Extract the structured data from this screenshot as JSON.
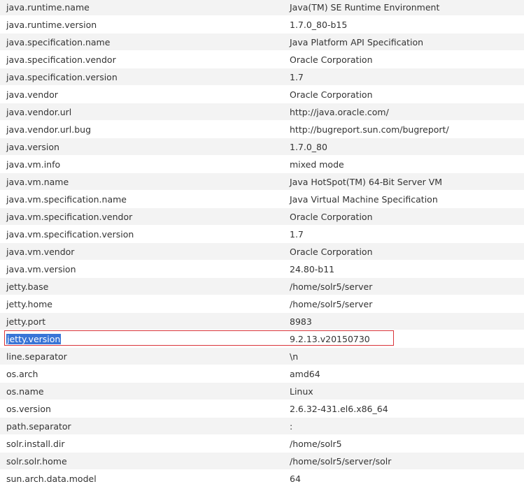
{
  "properties": [
    {
      "key": "java.runtime.name",
      "value": "Java(TM) SE Runtime Environment"
    },
    {
      "key": "java.runtime.version",
      "value": "1.7.0_80-b15"
    },
    {
      "key": "java.specification.name",
      "value": "Java Platform API Specification"
    },
    {
      "key": "java.specification.vendor",
      "value": "Oracle Corporation"
    },
    {
      "key": "java.specification.version",
      "value": "1.7"
    },
    {
      "key": "java.vendor",
      "value": "Oracle Corporation"
    },
    {
      "key": "java.vendor.url",
      "value": "http://java.oracle.com/"
    },
    {
      "key": "java.vendor.url.bug",
      "value": "http://bugreport.sun.com/bugreport/"
    },
    {
      "key": "java.version",
      "value": "1.7.0_80"
    },
    {
      "key": "java.vm.info",
      "value": "mixed mode"
    },
    {
      "key": "java.vm.name",
      "value": "Java HotSpot(TM) 64-Bit Server VM"
    },
    {
      "key": "java.vm.specification.name",
      "value": "Java Virtual Machine Specification"
    },
    {
      "key": "java.vm.specification.vendor",
      "value": "Oracle Corporation"
    },
    {
      "key": "java.vm.specification.version",
      "value": "1.7"
    },
    {
      "key": "java.vm.vendor",
      "value": "Oracle Corporation"
    },
    {
      "key": "java.vm.version",
      "value": "24.80-b11"
    },
    {
      "key": "jetty.base",
      "value": "/home/solr5/server"
    },
    {
      "key": "jetty.home",
      "value": "/home/solr5/server"
    },
    {
      "key": "jetty.port",
      "value": "8983"
    },
    {
      "key": "jetty.version",
      "value": "9.2.13.v20150730",
      "selected": true
    },
    {
      "key": "line.separator",
      "value": "\\n"
    },
    {
      "key": "os.arch",
      "value": "amd64"
    },
    {
      "key": "os.name",
      "value": "Linux"
    },
    {
      "key": "os.version",
      "value": "2.6.32-431.el6.x86_64"
    },
    {
      "key": "path.separator",
      "value": ":"
    },
    {
      "key": "solr.install.dir",
      "value": "/home/solr5"
    },
    {
      "key": "solr.solr.home",
      "value": "/home/solr5/server/solr"
    },
    {
      "key": "sun.arch.data.model",
      "value": "64"
    }
  ],
  "colors": {
    "stripe": "#f3f3f3",
    "text": "#333333",
    "selection": "#3875d7",
    "highlight_border": "#d9343a"
  }
}
